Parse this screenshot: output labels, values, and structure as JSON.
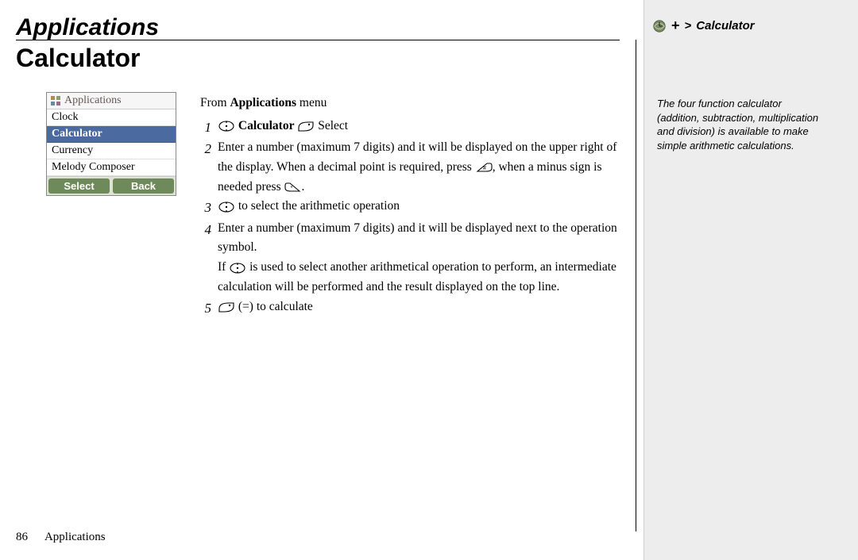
{
  "section_title": "Applications",
  "page_title": "Calculator",
  "sidebar": {
    "breadcrumb_symbol": ">",
    "breadcrumb_label": "Calculator",
    "note": "The four function calculator (addition, subtraction, multiplication and division) is available to make simple arithmetic calculations."
  },
  "phone": {
    "header": "Applications",
    "items": [
      "Clock",
      "Calculator",
      "Currency",
      "Melody Composer"
    ],
    "selected_index": 1,
    "soft_left": "Select",
    "soft_right": "Back"
  },
  "lead_prefix": "From ",
  "lead_bold": "Applications",
  "lead_suffix": " menu",
  "steps": {
    "s1_bold": "Calculator",
    "s1_after": " Select",
    "s2_a": "Enter a number (maximum 7 digits) and it will be displayed on the upper right of the display. When a decimal point is required, press ",
    "s2_b": ", when a minus sign is needed press ",
    "s2_c": ".",
    "s3": " to select the arithmetic operation",
    "s4_a": "Enter a number (maximum 7 digits) and it will be displayed next to the operation symbol.",
    "s4_b": "If ",
    "s4_c": " is used to select another arithmetical operation to perform, an intermediate calculation will be performed and the result displayed on the top line.",
    "s5": " (=) to calculate"
  },
  "step_numbers": [
    "1",
    "2",
    "3",
    "4",
    "5"
  ],
  "footer": {
    "page_number": "86",
    "section": "Applications"
  }
}
